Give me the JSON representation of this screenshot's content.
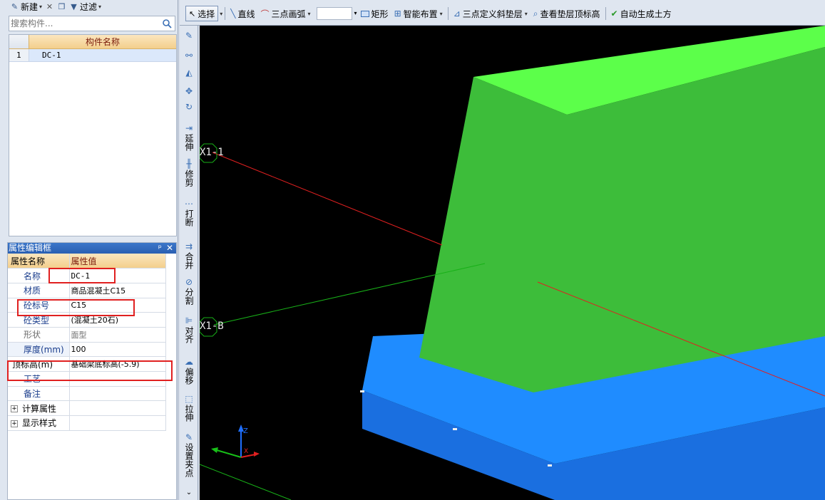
{
  "left_toolbar": {
    "new_label": "新建",
    "filter_label": "过滤"
  },
  "search": {
    "placeholder": "搜索构件..."
  },
  "component_list": {
    "header": "构件名称",
    "rows": [
      {
        "index": "1",
        "name": "DC-1"
      }
    ]
  },
  "property_panel": {
    "title": "属性编辑框",
    "col_name": "属性名称",
    "col_value": "属性值",
    "rows": [
      {
        "name": "名称",
        "value": "DC-1"
      },
      {
        "name": "材质",
        "value": "商品混凝土C15"
      },
      {
        "name": "砼标号",
        "value": "C15"
      },
      {
        "name": "砼类型",
        "value": "(混凝土20石)"
      },
      {
        "name": "形状",
        "value": "面型"
      },
      {
        "name": "厚度(mm)",
        "value": "100"
      },
      {
        "name": "顶标高(m)",
        "value": "基础梁底标高(-5.9)"
      },
      {
        "name": "工艺",
        "value": ""
      },
      {
        "name": "备注",
        "value": ""
      },
      {
        "name": "计算属性",
        "value": ""
      },
      {
        "name": "显示样式",
        "value": ""
      }
    ]
  },
  "top_toolbar": {
    "select": "选择",
    "line": "直线",
    "arc": "三点画弧",
    "rect": "矩形",
    "smart_layout": "智能布置",
    "define_slope": "三点定义斜垫层",
    "view_top_elev": "查看垫层顶标高",
    "auto_earthwork": "自动生成土方"
  },
  "vertical_tools": {
    "extend": "延伸",
    "trim": "修剪",
    "break": "打断",
    "merge": "合并",
    "split": "分割",
    "align": "对齐",
    "offset": "偏移",
    "stretch": "拉伸",
    "grip": "设置夹点"
  },
  "viewport": {
    "axis_labels": [
      "X1-1",
      "X1-B"
    ],
    "colors": {
      "background": "#000000",
      "green_top": "#5cff4a",
      "green_front": "#3dbd3a",
      "blue_top": "#1f8cff",
      "blue_front": "#1a6fe0"
    }
  }
}
